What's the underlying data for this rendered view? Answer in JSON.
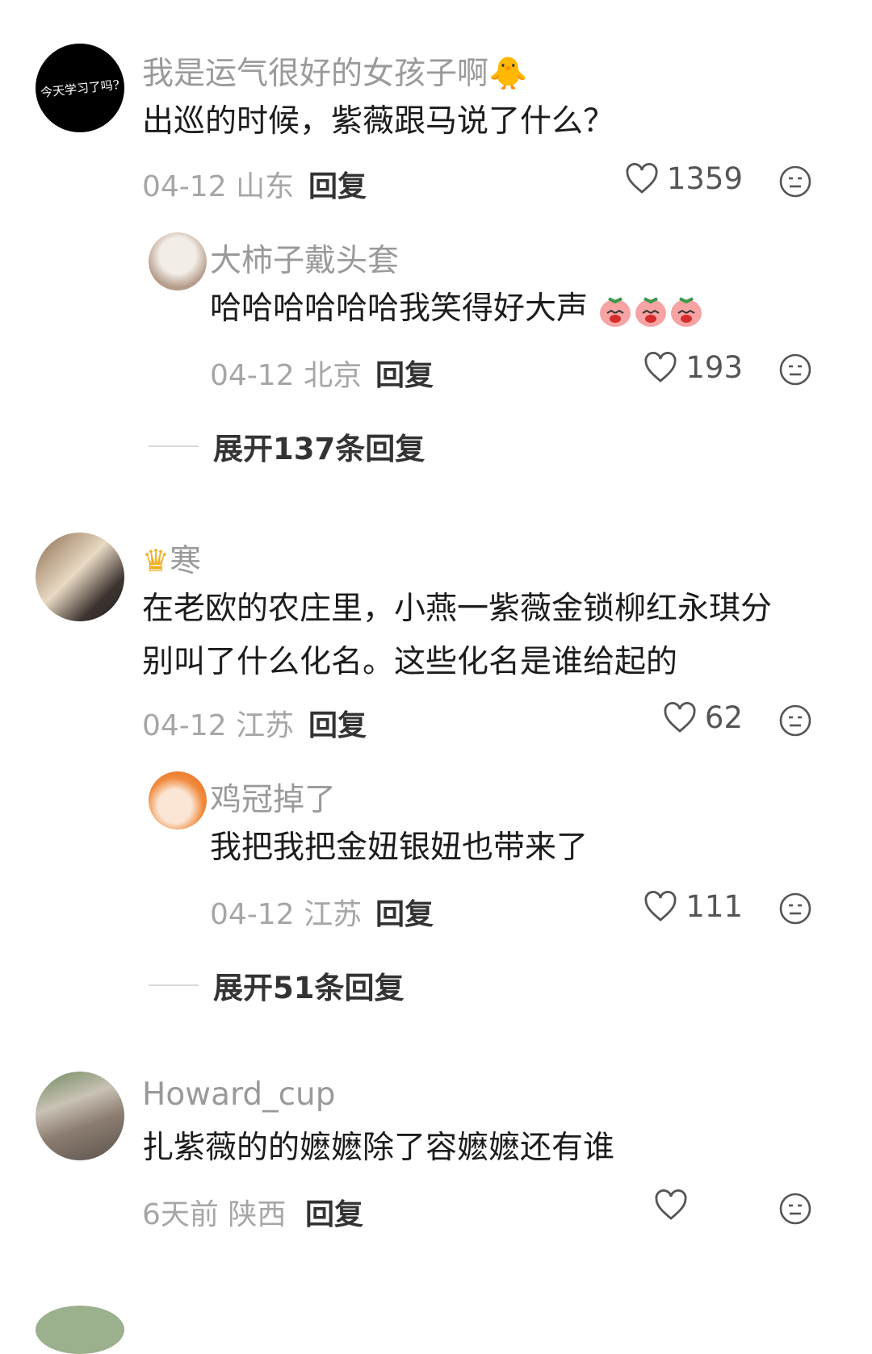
{
  "comments": [
    {
      "user": "我是运气很好的女孩子啊🐥",
      "avatar_text": "今天学习了吗?",
      "text": "出巡的时候，紫薇跟马说了什么？",
      "date": "04-12",
      "location": "山东",
      "reply_label": "回复",
      "likes": "1359",
      "reply": {
        "user": "大柿子戴头套",
        "text": "哈哈哈哈哈哈我笑得好大声",
        "date": "04-12",
        "location": "北京",
        "reply_label": "回复",
        "likes": "193"
      },
      "expand_label": "展开137条回复"
    },
    {
      "user": "寒",
      "text_line1": "在老欧的农庄里，小燕一紫薇金锁柳红永琪分",
      "text_line2": "别叫了什么化名。这些化名是谁给起的",
      "date": "04-12",
      "location": "江苏",
      "reply_label": "回复",
      "likes": "62",
      "reply": {
        "user": "鸡冠掉了",
        "text": "我把我把金妞银妞也带来了",
        "date": "04-12",
        "location": "江苏",
        "reply_label": "回复",
        "likes": "111"
      },
      "expand_label": "展开51条回复"
    },
    {
      "user": "Howard_cup",
      "text": "扎紫薇的的嬷嬷除了容嬷嬷还有谁",
      "date": "6天前",
      "location": "陕西",
      "reply_label": "回复",
      "likes": ""
    }
  ],
  "colors": {
    "name": "#9a9a9a",
    "meta": "#a6a6a6",
    "text": "#1c1c1c"
  },
  "icons": [
    "heart-icon",
    "dislike-face-icon",
    "crown-icon",
    "laughing-peach-emoji"
  ]
}
